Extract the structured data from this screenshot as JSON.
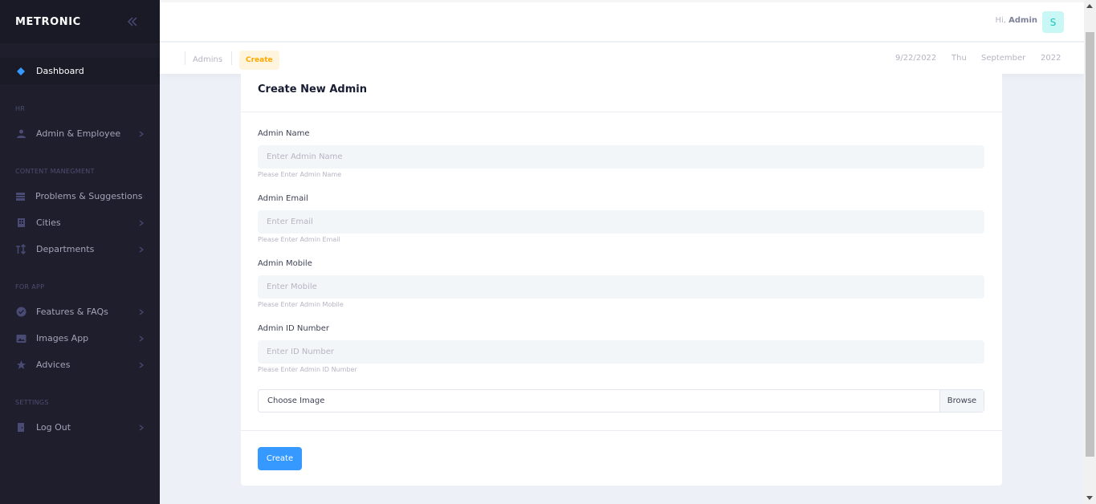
{
  "sidebar": {
    "brand": "METRONIC",
    "items": {
      "dashboard": "Dashboard",
      "admin_employee": "Admin & Employee",
      "problems": "Problems & Suggestions",
      "cities": "Cities",
      "departments": "Departments",
      "features": "Features & FAQs",
      "images": "Images App",
      "advices": "Advices",
      "logout": "Log Out"
    },
    "sections": {
      "hr": "HR",
      "content": "CONTENT MANEGMENT",
      "app": "FOR APP",
      "settings": "SETTINGS"
    }
  },
  "header": {
    "greeting": "Hi,",
    "user_name": "Admin",
    "avatar_letter": "S"
  },
  "subheader": {
    "crumb_admins": "Admins",
    "crumb_create": "Create",
    "date": "9/22/2022",
    "day": "Thu",
    "month": "September",
    "year": "2022"
  },
  "form": {
    "title": "Create New Admin",
    "name": {
      "label": "Admin Name",
      "placeholder": "Enter Admin Name",
      "hint": "Please Enter Admin Name"
    },
    "email": {
      "label": "Admin Email",
      "placeholder": "Enter Email",
      "hint": "Please Enter Admin Email"
    },
    "mobile": {
      "label": "Admin Mobile",
      "placeholder": "Enter Mobile",
      "hint": "Please Enter Admin Mobile"
    },
    "id_number": {
      "label": "Admin ID Number",
      "placeholder": "Enter ID Number",
      "hint": "Please Enter Admin ID Number"
    },
    "file": {
      "label": "Choose Image",
      "browse": "Browse"
    },
    "submit": "Create"
  },
  "colors": {
    "sidebar_bg": "#1e1e2d",
    "primary": "#3699ff",
    "warning_light": "#fff4de",
    "warning": "#ffa800",
    "avatar_bg": "#c9f7f5",
    "avatar_fg": "#1bc5bd"
  },
  "icons": [
    "collapse-icon",
    "dashboard-icon",
    "user-icon",
    "layers-icon",
    "building-icon",
    "sort-icon",
    "check-circle-icon",
    "image-icon",
    "star-icon",
    "door-icon",
    "chevron-right-icon"
  ]
}
